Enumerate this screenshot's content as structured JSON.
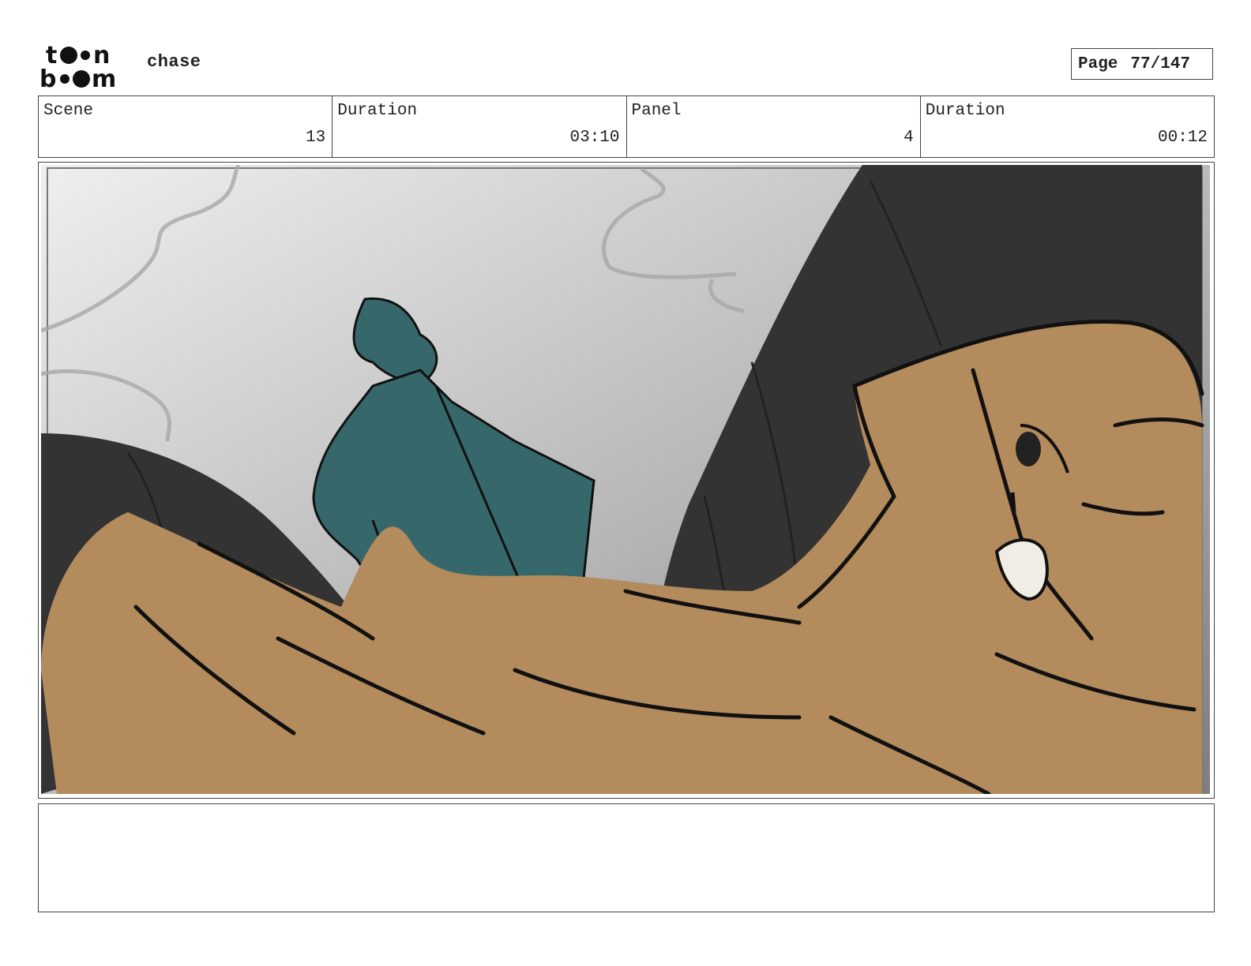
{
  "header": {
    "logo_text": "toon boom",
    "project_title": "chase",
    "page_label": "Page",
    "page_number": "77/147"
  },
  "info": {
    "scene_label": "Scene",
    "scene_value": "13",
    "scene_duration_label": "Duration",
    "scene_duration_value": "03:10",
    "panel_label": "Panel",
    "panel_value": "4",
    "panel_duration_label": "Duration",
    "panel_duration_value": "00:12"
  },
  "colors": {
    "skin": "#b38b5c",
    "teal": "#36686b",
    "dark": "#333333",
    "sky_light": "#eeeeee",
    "sky_dark": "#8a8a8a"
  },
  "notes": {
    "text": ""
  }
}
